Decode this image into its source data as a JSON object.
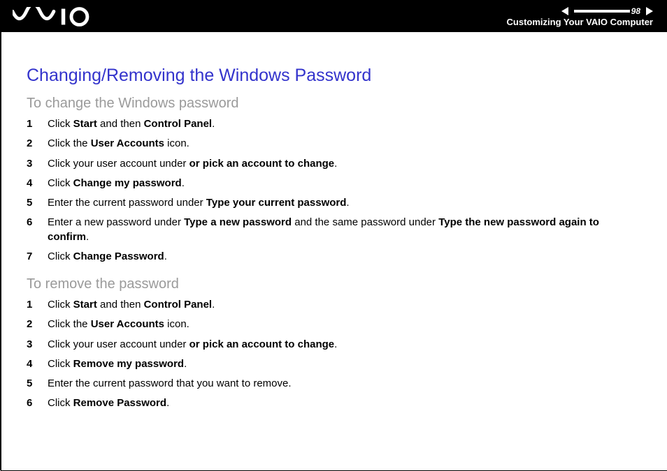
{
  "header": {
    "page_number": "98",
    "breadcrumb": "Customizing Your VAIO Computer"
  },
  "title": "Changing/Removing the Windows Password",
  "sections": [
    {
      "heading": "To change the Windows password",
      "steps": [
        {
          "n": "1",
          "segments": [
            {
              "t": "Click "
            },
            {
              "t": "Start",
              "b": true
            },
            {
              "t": " and then "
            },
            {
              "t": "Control Panel",
              "b": true
            },
            {
              "t": "."
            }
          ]
        },
        {
          "n": "2",
          "segments": [
            {
              "t": "Click the "
            },
            {
              "t": "User Accounts",
              "b": true
            },
            {
              "t": " icon."
            }
          ]
        },
        {
          "n": "3",
          "segments": [
            {
              "t": "Click your user account under "
            },
            {
              "t": "or pick an account to change",
              "b": true
            },
            {
              "t": "."
            }
          ]
        },
        {
          "n": "4",
          "segments": [
            {
              "t": "Click "
            },
            {
              "t": "Change my password",
              "b": true
            },
            {
              "t": "."
            }
          ]
        },
        {
          "n": "5",
          "segments": [
            {
              "t": "Enter the current password under "
            },
            {
              "t": "Type your current password",
              "b": true
            },
            {
              "t": "."
            }
          ]
        },
        {
          "n": "6",
          "segments": [
            {
              "t": "Enter a new password under "
            },
            {
              "t": "Type a new password",
              "b": true
            },
            {
              "t": " and the same password under "
            },
            {
              "t": "Type the new password again to confirm",
              "b": true
            },
            {
              "t": "."
            }
          ]
        },
        {
          "n": "7",
          "segments": [
            {
              "t": "Click "
            },
            {
              "t": "Change Password",
              "b": true
            },
            {
              "t": "."
            }
          ]
        }
      ]
    },
    {
      "heading": "To remove the password",
      "steps": [
        {
          "n": "1",
          "segments": [
            {
              "t": "Click "
            },
            {
              "t": "Start",
              "b": true
            },
            {
              "t": " and then "
            },
            {
              "t": "Control Panel",
              "b": true
            },
            {
              "t": "."
            }
          ]
        },
        {
          "n": "2",
          "segments": [
            {
              "t": "Click the "
            },
            {
              "t": "User Accounts",
              "b": true
            },
            {
              "t": " icon."
            }
          ]
        },
        {
          "n": "3",
          "segments": [
            {
              "t": "Click your user account under "
            },
            {
              "t": "or pick an account to change",
              "b": true
            },
            {
              "t": "."
            }
          ]
        },
        {
          "n": "4",
          "segments": [
            {
              "t": "Click "
            },
            {
              "t": "Remove my password",
              "b": true
            },
            {
              "t": "."
            }
          ]
        },
        {
          "n": "5",
          "segments": [
            {
              "t": "Enter the current password that you want to remove."
            }
          ]
        },
        {
          "n": "6",
          "segments": [
            {
              "t": "Click "
            },
            {
              "t": "Remove Password",
              "b": true
            },
            {
              "t": "."
            }
          ]
        }
      ]
    }
  ]
}
